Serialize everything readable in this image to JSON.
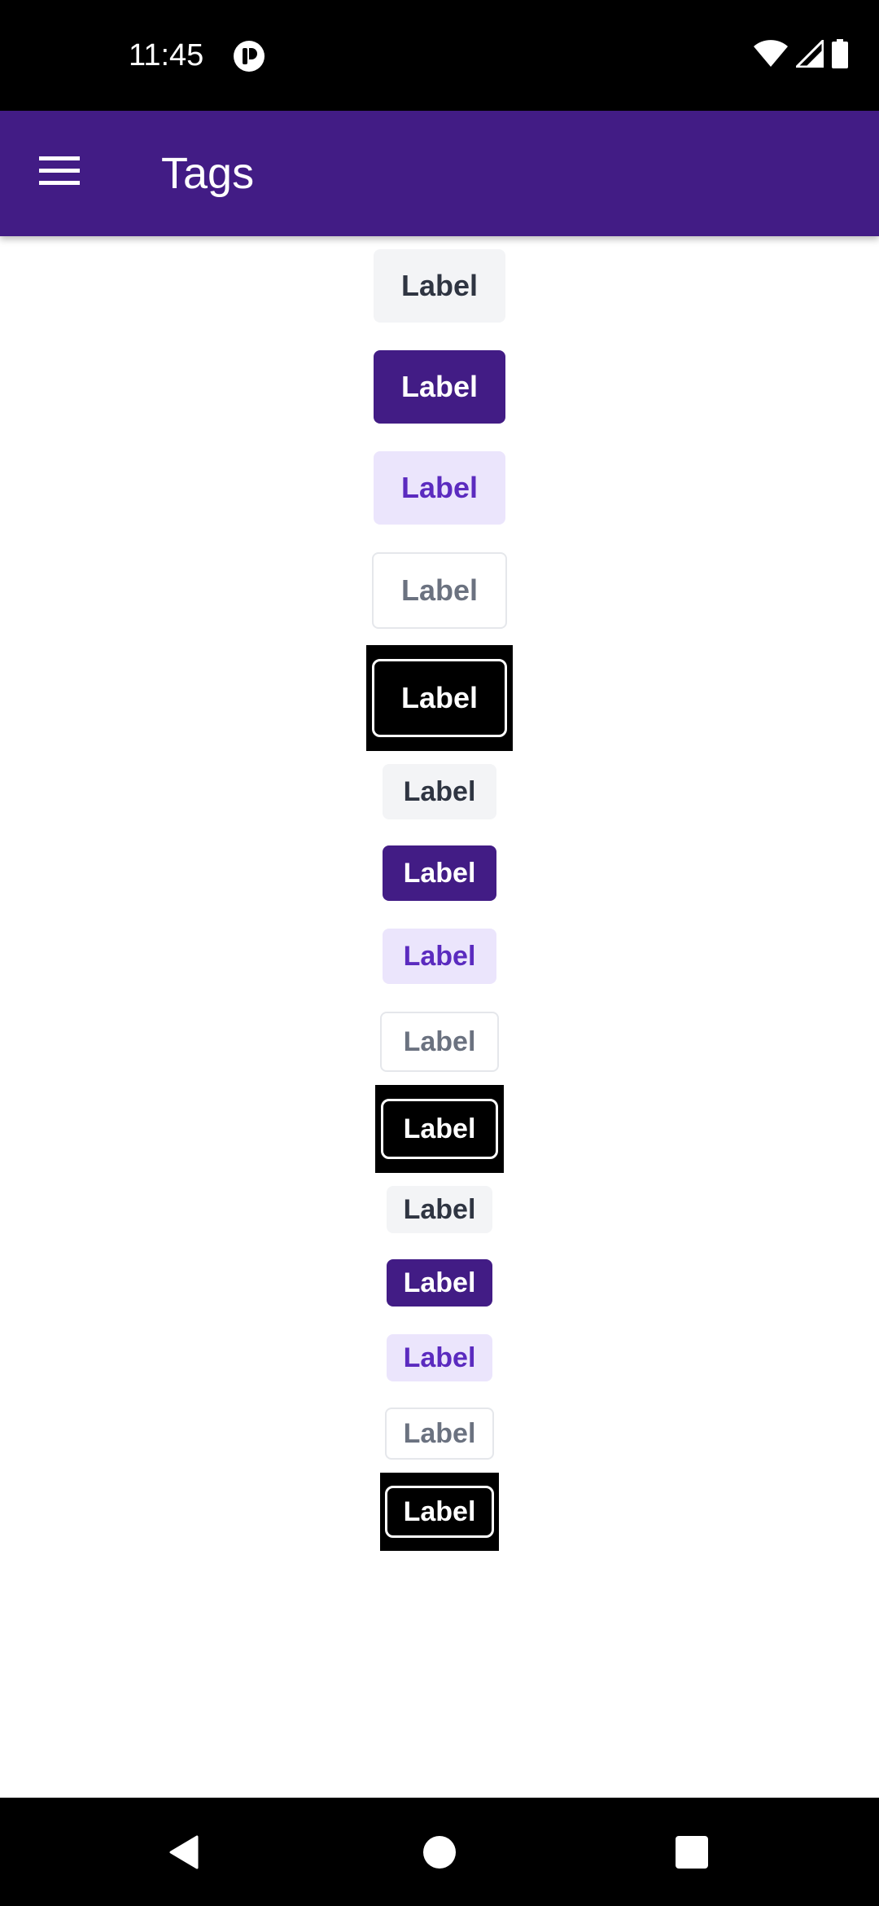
{
  "status_bar": {
    "time": "11:45",
    "icons": [
      "app-notification-icon",
      "wifi-icon",
      "cellular-signal-icon",
      "battery-icon"
    ]
  },
  "app_bar": {
    "title": "Tags",
    "menu_icon": "hamburger-menu-icon",
    "background": "#421c85"
  },
  "tags": {
    "large": {
      "gray": "Label",
      "primary": "Label",
      "light": "Label",
      "outline": "Label",
      "focused": "Label"
    },
    "medium": {
      "gray": "Label",
      "primary": "Label",
      "light": "Label",
      "outline": "Label",
      "focused": "Label"
    },
    "small": {
      "gray": "Label",
      "primary": "Label",
      "light": "Label",
      "outline": "Label",
      "focused": "Label"
    }
  },
  "nav_bar": {
    "buttons": [
      "back-icon",
      "home-icon",
      "recents-icon"
    ]
  },
  "colors": {
    "primary": "#421c85",
    "light_bg": "#ebe5fc",
    "light_text": "#5b2bbf",
    "gray_bg": "#f3f4f6",
    "gray_text": "#2f3542",
    "outline_text": "#6b7280"
  }
}
